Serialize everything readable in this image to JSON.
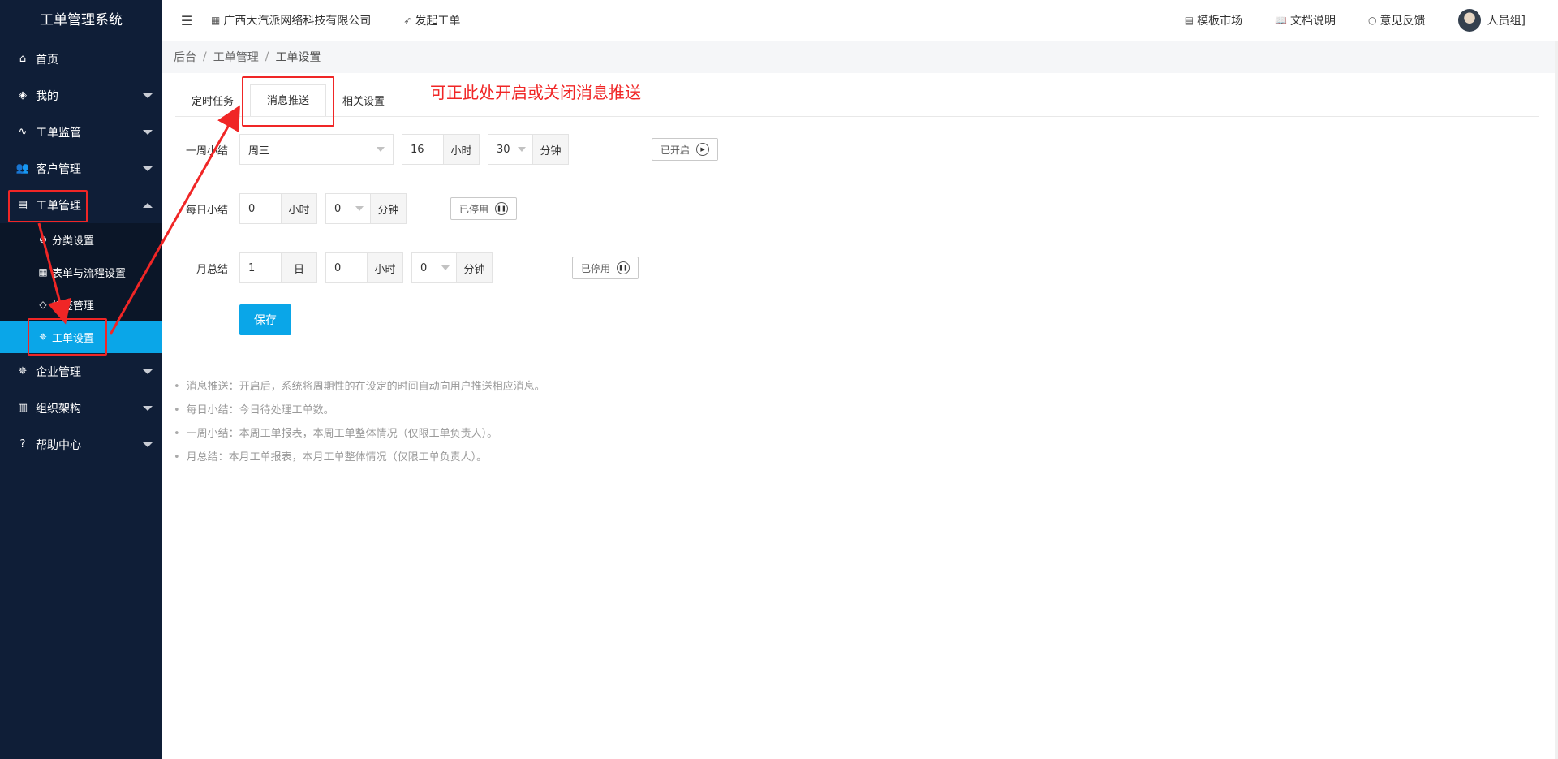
{
  "sidebar": {
    "title": "工单管理系统",
    "items": [
      {
        "label": "首页",
        "icon": "home-icon"
      },
      {
        "label": "我的",
        "icon": "layers-icon"
      },
      {
        "label": "工单监管",
        "icon": "pulse-icon"
      },
      {
        "label": "客户管理",
        "icon": "users-icon"
      },
      {
        "label": "工单管理",
        "icon": "clipboard-icon"
      },
      {
        "label": "企业管理",
        "icon": "gear-icon"
      },
      {
        "label": "组织架构",
        "icon": "calendar-icon"
      },
      {
        "label": "帮助中心",
        "icon": "question-icon"
      }
    ],
    "submenu": [
      {
        "label": "分类设置",
        "icon": "category-icon"
      },
      {
        "label": "表单与流程设置",
        "icon": "table-icon"
      },
      {
        "label": "标签管理",
        "icon": "tag-icon"
      },
      {
        "label": "工单设置",
        "icon": "gear-icon"
      }
    ]
  },
  "topbar": {
    "company": "广西大汽派网络科技有限公司",
    "create_ticket": "发起工单",
    "template_market": "模板市场",
    "docs": "文档说明",
    "feedback": "意见反馈",
    "user_group": "人员组]"
  },
  "breadcrumb": {
    "items": [
      "后台",
      "工单管理",
      "工单设置"
    ]
  },
  "tabs": [
    "定时任务",
    "消息推送",
    "相关设置"
  ],
  "annotation": "可正此处开启或关闭消息推送",
  "form": {
    "weekly": {
      "label": "一周小结",
      "day": "周三",
      "hour": "16",
      "hour_unit": "小时",
      "minute": "30",
      "minute_unit": "分钟",
      "status": "已开启"
    },
    "daily": {
      "label": "每日小结",
      "hour": "0",
      "hour_unit": "小时",
      "minute": "0",
      "minute_unit": "分钟",
      "status": "已停用"
    },
    "monthly": {
      "label": "月总结",
      "day": "1",
      "day_unit": "日",
      "hour": "0",
      "hour_unit": "小时",
      "minute": "0",
      "minute_unit": "分钟",
      "status": "已停用"
    },
    "save_label": "保存"
  },
  "notes": [
    "消息推送：开启后，系统将周期性的在设定的时间自动向用户推送相应消息。",
    "每日小结：今日待处理工单数。",
    "一周小结：本周工单报表，本周工单整体情况（仅限工单负责人）。",
    "月总结：本月工单报表，本月工单整体情况（仅限工单负责人）。"
  ],
  "colors": {
    "sidebar_bg": "#0f1e37",
    "accent": "#0aa6e8",
    "annotation_red": "#f02626"
  }
}
